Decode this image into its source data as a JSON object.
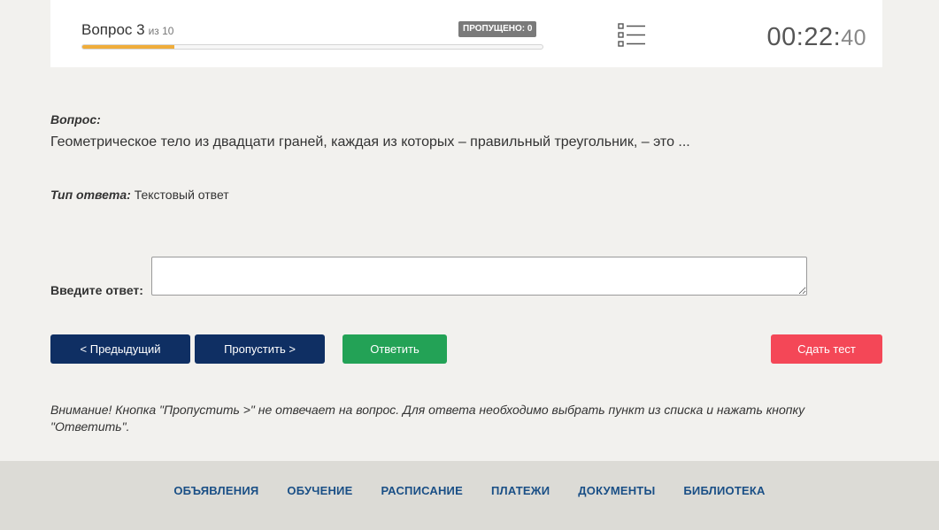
{
  "header": {
    "question_label": "Вопрос 3",
    "question_of": "из 10",
    "skipped_badge": "ПРОПУЩЕНО: 0",
    "progress": 0.2,
    "timer_main": "00:22:",
    "timer_seconds": "40",
    "list_icon": "list-icon"
  },
  "question": {
    "label": "Вопрос:",
    "text": "Геометрическое тело из двадцати граней, каждая из которых – правильный треугольник, – это ...",
    "type_label": "Тип ответа:",
    "type_value": "Текстовый ответ"
  },
  "answer": {
    "label": "Введите ответ:",
    "value": ""
  },
  "buttons": {
    "prev": "< Предыдущий",
    "skip": "Пропустить >",
    "answer": "Ответить",
    "submit": "Сдать тест"
  },
  "notice": "Внимание! Кнопка \"Пропустить >\" не отвечает на вопрос. Для ответа необходимо выбрать пункт из списка и нажать кнопку \"Ответить\".",
  "footer": {
    "links": [
      "ОБЪЯВЛЕНИЯ",
      "ОБУЧЕНИЕ",
      "РАСПИСАНИЕ",
      "ПЛАТЕЖИ",
      "ДОКУМЕНТЫ",
      "БИБЛИОТЕКА"
    ]
  },
  "colors": {
    "progress": "#f0ad3a",
    "nav_button": "#0f2f63",
    "answer_button": "#23a256",
    "submit_button": "#f44757",
    "footer_link": "#1a4f86"
  }
}
